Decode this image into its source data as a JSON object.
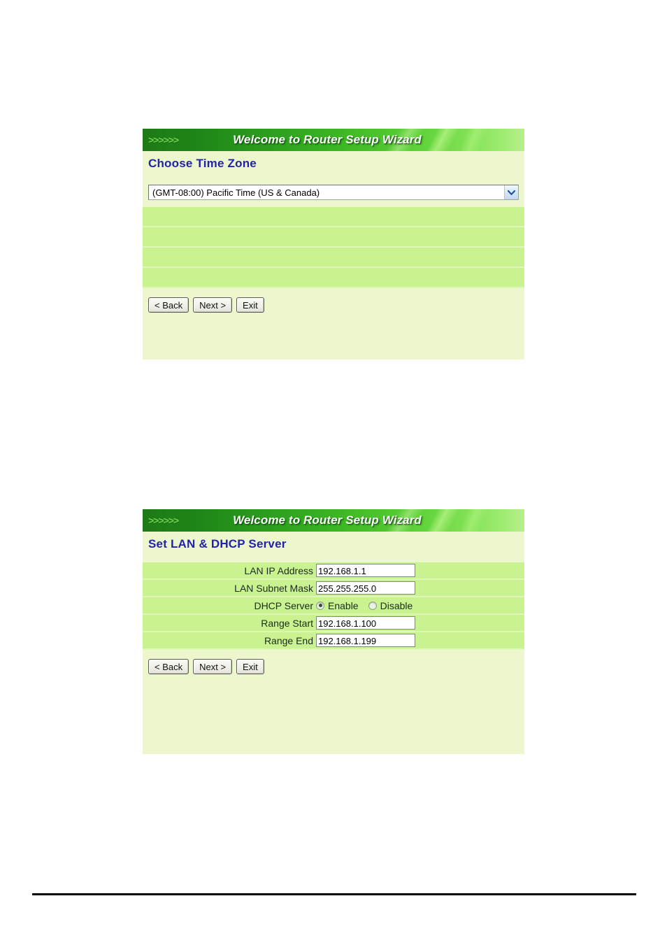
{
  "banner": {
    "arrows": ">>>>>>",
    "title": "Welcome to Router Setup Wizard"
  },
  "buttons": {
    "back": "< Back",
    "next": "Next >",
    "exit": "Exit"
  },
  "panels": {
    "timezone": {
      "section_title": "Choose Time Zone",
      "select": {
        "selected": "(GMT-08:00) Pacific Time (US & Canada)",
        "icon": "chevron-down-icon"
      },
      "empty_rows": 4
    },
    "lan": {
      "section_title": "Set LAN & DHCP Server",
      "fields": [
        {
          "label": "LAN IP Address",
          "value": "192.168.1.1",
          "type": "text"
        },
        {
          "label": "LAN Subnet Mask",
          "value": "255.255.255.0",
          "type": "text"
        },
        {
          "label": "DHCP Server",
          "type": "radio",
          "options": [
            {
              "label": "Enable",
              "checked": true
            },
            {
              "label": "Disable",
              "checked": false
            }
          ]
        },
        {
          "label": "Range Start",
          "value": "192.168.1.100",
          "type": "text"
        },
        {
          "label": "Range End",
          "value": "192.168.1.199",
          "type": "text"
        }
      ]
    }
  },
  "colors": {
    "panel_bg": "#edf7cd",
    "row_bg": "#c9f391",
    "row_sep": "#dff7b6",
    "title_blue": "#2222aa",
    "banner_dark_green": "#1d7a16",
    "banner_light_green": "#b7f18c"
  }
}
